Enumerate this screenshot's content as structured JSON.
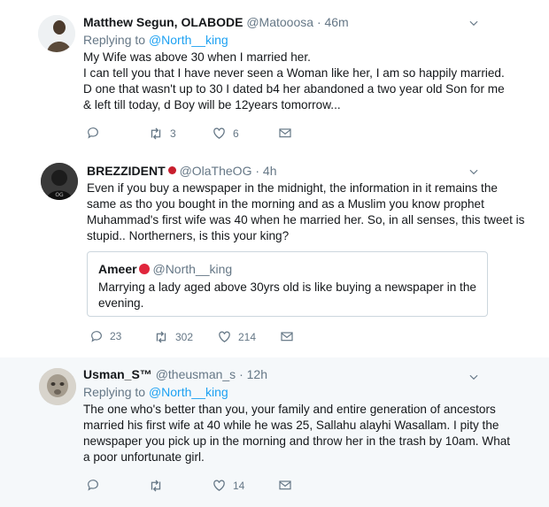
{
  "tweets": [
    {
      "name": "Matthew Segun, OLABODE",
      "handle": "@Matooosa",
      "time": "· 46m",
      "replying_label": "Replying to ",
      "replying_to": "@North__king",
      "lines": [
        "My Wife was above 30 when I married her.",
        "I can tell you that I have never seen a Woman like her, I am so happily married.",
        "D one that wasn't up to 30 I dated b4 her abandoned a two year old Son for me",
        "& left till today, d Boy will be 12years tomorrow..."
      ],
      "retweets": "3",
      "likes": "6",
      "replies": ""
    },
    {
      "name": "BREZZIDENT",
      "handle": "@OlaTheOG",
      "time": "· 4h",
      "lines": [
        "Even if you buy a newspaper in the midnight, the information in it remains the",
        "same as tho you bought in the morning and as a Muslim you know prophet",
        "Muhammad's first wife was 40 when he married her. So, in all senses, this tweet is",
        "stupid.. Northerners, is this your king?"
      ],
      "quote": {
        "name": "Ameer",
        "handle": "@North__king",
        "lines": [
          "Marrying a lady aged above 30yrs old is like buying a newspaper in the",
          "evening."
        ]
      },
      "replies": "23",
      "retweets": "302",
      "likes": "214"
    },
    {
      "name": "Usman_S™",
      "handle": "@theusman_s",
      "time": "· 12h",
      "replying_label": "Replying to ",
      "replying_to": "@North__king",
      "lines": [
        "The one who's better than you, your family and entire generation of ancestors",
        "married his first wife at 40 while he was 25, Sallahu alayhi Wasallam. I pity the",
        "newspaper you pick up in the morning and throw her in the trash by 10am. What",
        "a poor unfortunate girl."
      ],
      "replies": "",
      "retweets": "",
      "likes": "14"
    }
  ],
  "colors": {
    "link": "#1da1f2",
    "muted": "#657786",
    "text": "#14171a"
  }
}
